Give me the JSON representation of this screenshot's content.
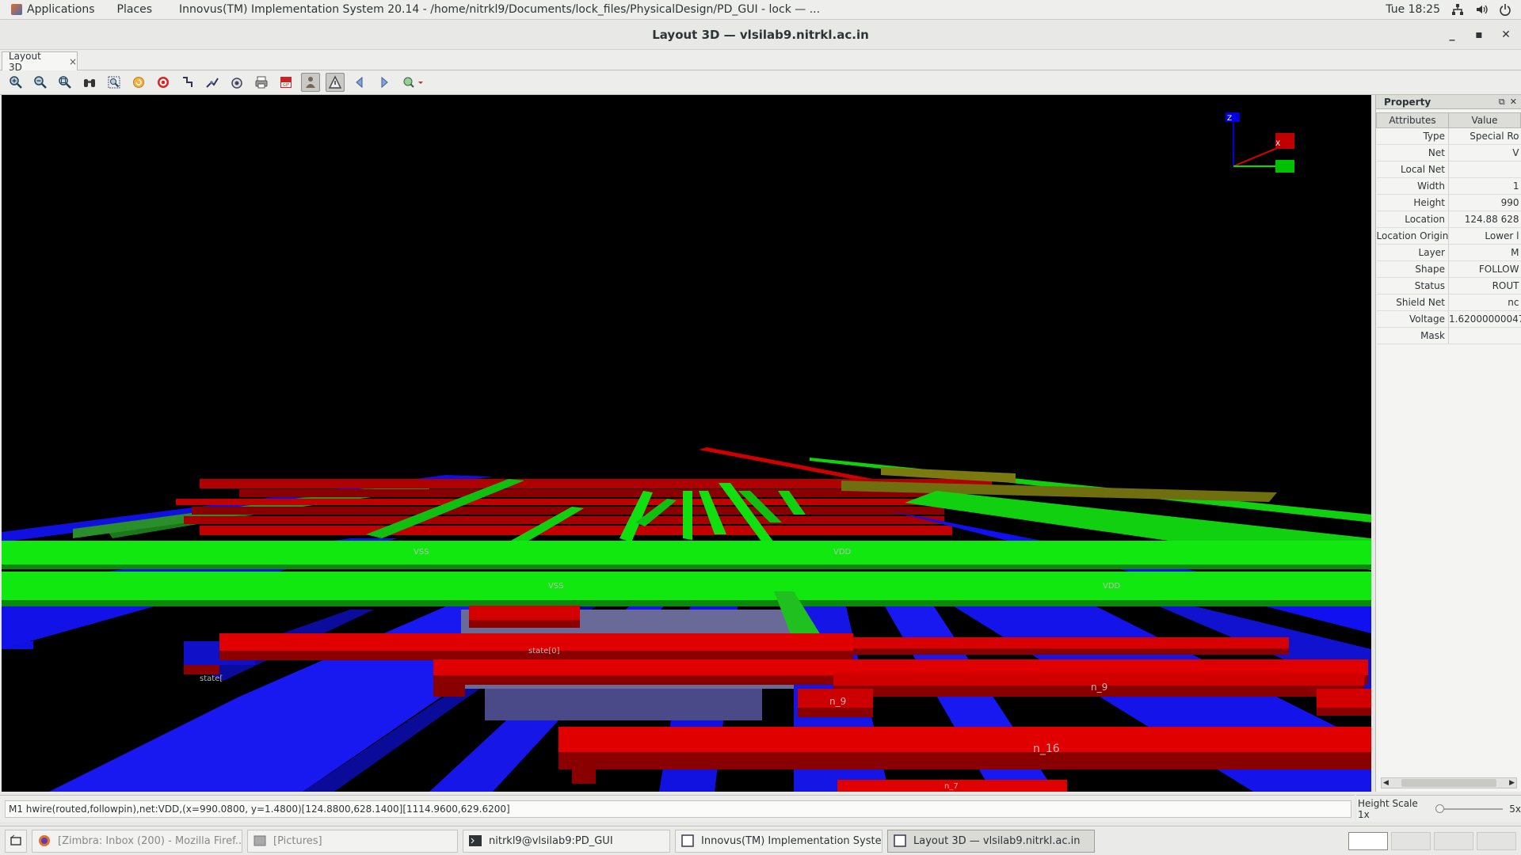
{
  "top_panel": {
    "applications_label": "Applications",
    "places_label": "Places",
    "window_title": "Innovus(TM) Implementation System 20.14 - /home/nitrkl9/Documents/lock_files/PhysicalDesign/PD_GUI - lock — ...",
    "clock": "Tue 18:25"
  },
  "window": {
    "title": "Layout 3D — vlsilab9.nitrkl.ac.in",
    "minimize": "_",
    "maximize": "▪",
    "close": "✕"
  },
  "tab": {
    "label": "Layout 3D",
    "close": "×"
  },
  "toolbar": {
    "icons": [
      "zoom-in-icon",
      "zoom-out-icon",
      "zoom-fit-icon",
      "binoculars-icon",
      "zoom-area-icon",
      "refresh-icon",
      "target-icon",
      "route-icon",
      "wire-tool-icon",
      "camera-icon",
      "print-icon",
      "gif-record-icon",
      "layers-person-icon",
      "warning-icon",
      "back-arrow-icon",
      "forward-arrow-icon",
      "rotate-options-icon"
    ]
  },
  "viewport": {
    "axis_labels": {
      "z": "Z",
      "x": "X"
    },
    "net_labels": [
      "VSS",
      "VDD",
      "VSS",
      "VDD",
      "state[0]",
      "state[",
      "n_9",
      "n_9",
      "n_16",
      "n_7"
    ]
  },
  "property_panel": {
    "title": "Property",
    "col_attributes": "Attributes",
    "col_value": "Value",
    "rows": [
      {
        "attr": "Type",
        "value": "Special Ro"
      },
      {
        "attr": "Net",
        "value": "V"
      },
      {
        "attr": "Local Net",
        "value": ""
      },
      {
        "attr": "Width",
        "value": "1"
      },
      {
        "attr": "Height",
        "value": "990"
      },
      {
        "attr": "Location",
        "value": "124.88 628"
      },
      {
        "attr": "Location Origin",
        "value": "Lower l"
      },
      {
        "attr": "Layer",
        "value": "M"
      },
      {
        "attr": "Shape",
        "value": "FOLLOW"
      },
      {
        "attr": "Status",
        "value": "ROUT"
      },
      {
        "attr": "Shield Net",
        "value": "nc"
      },
      {
        "attr": "Voltage",
        "value": "1.62000000047"
      },
      {
        "attr": "Mask",
        "value": ""
      }
    ]
  },
  "status": {
    "text": "M1 hwire(routed,followpin),net:VDD,(x=990.0800, y=1.4800)[124.8800,628.1400][1114.9600,629.6200]",
    "height_scale_label": "Height Scale 1x",
    "height_scale_max": "5x",
    "height_scale_value": 1
  },
  "taskbar": {
    "tasks": [
      {
        "label": "[Zimbra: Inbox (200) - Mozilla Firef...",
        "icon": "firefox-icon"
      },
      {
        "label": "[Pictures]",
        "icon": "folder-icon"
      },
      {
        "label": "nitrkl9@vlsilab9:PD_GUI",
        "icon": "terminal-icon"
      },
      {
        "label": "Innovus(TM) Implementation Syste...",
        "icon": "window-icon"
      },
      {
        "label": "Layout 3D — vlsilab9.nitrkl.ac.in",
        "icon": "window-icon"
      }
    ]
  }
}
